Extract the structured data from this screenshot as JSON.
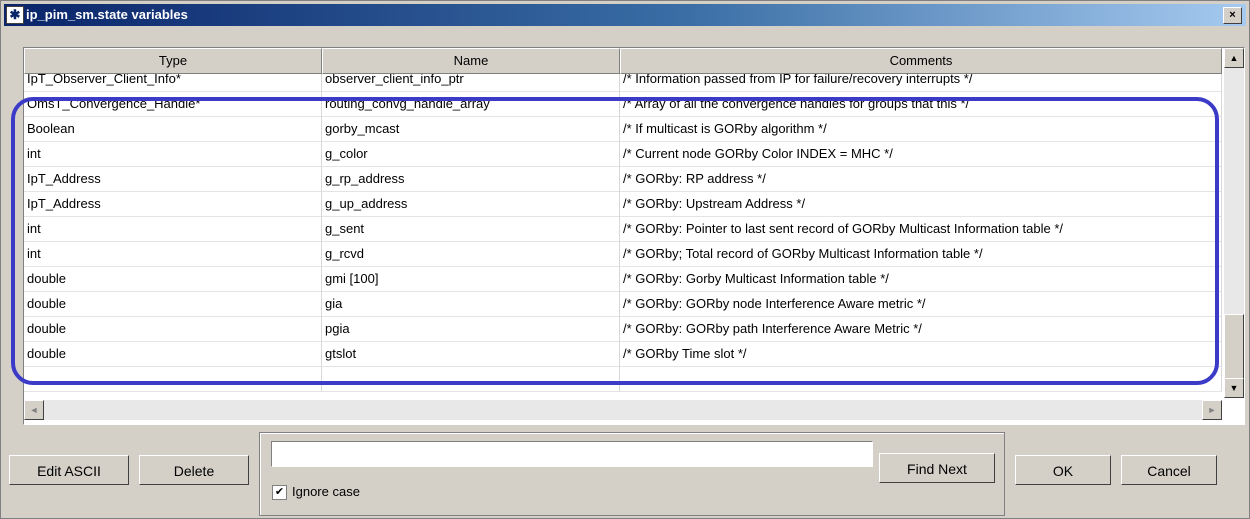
{
  "window": {
    "title": "ip_pim_sm.state variables",
    "close_glyph": "×"
  },
  "table": {
    "columns": [
      "Type",
      "Name",
      "Comments"
    ],
    "rows": [
      {
        "type": "IpT_Observer_Client_Info*",
        "name": "observer_client_info_ptr",
        "comment": "/* Information passed from IP for failure/recovery interrupts */"
      },
      {
        "type": "OmsT_Convergence_Handle*",
        "name": "routing_convg_handle_array",
        "comment": "/* Array of all the convergence handles for groups that this */"
      },
      {
        "type": "Boolean",
        "name": "gorby_mcast",
        "comment": "/* If multicast is GORby algorithm */"
      },
      {
        "type": "int",
        "name": "g_color",
        "comment": "/* Current node GORby Color INDEX = MHC */"
      },
      {
        "type": "IpT_Address",
        "name": "g_rp_address",
        "comment": "/* GORby: RP address */"
      },
      {
        "type": "IpT_Address",
        "name": "g_up_address",
        "comment": "/* GORby: Upstream Address */"
      },
      {
        "type": "int",
        "name": "g_sent",
        "comment": "/* GORby: Pointer to last sent record of GORby Multicast Information table */"
      },
      {
        "type": "int",
        "name": "g_rcvd",
        "comment": "/* GORby; Total record of GORby Multicast Information table */"
      },
      {
        "type": "double",
        "name": "gmi [100]",
        "comment": "/* GORby: Gorby Multicast Information table */"
      },
      {
        "type": "double",
        "name": "gia",
        "comment": "/* GORby: GORby node Interference Aware metric */"
      },
      {
        "type": "double",
        "name": "pgia",
        "comment": "/* GORby: GORby path Interference Aware Metric */"
      },
      {
        "type": "double",
        "name": "gtslot",
        "comment": "/* GORby Time slot */"
      },
      {
        "type": "",
        "name": "",
        "comment": ""
      }
    ]
  },
  "scroll": {
    "up": "▲",
    "down": "▼",
    "left": "◄",
    "right": "►"
  },
  "buttons": {
    "edit_ascii": "Edit ASCII",
    "delete": "Delete",
    "find_next": "Find Next",
    "ok": "OK",
    "cancel": "Cancel"
  },
  "search": {
    "value": "",
    "ignore_case_label": "Ignore case",
    "ignore_case_checked": "✔"
  },
  "colors": {
    "title_bar": "#0a246a",
    "highlight_outline": "#3b3bc8",
    "dialog_bg": "#d4d0c8"
  }
}
